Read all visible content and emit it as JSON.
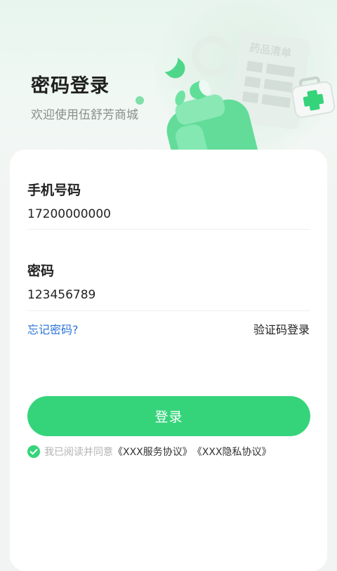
{
  "header": {
    "title": "密码登录",
    "subtitle": "欢迎使用伍舒芳商城",
    "illustration_sign": "药品清单"
  },
  "form": {
    "phone": {
      "label": "手机号码",
      "value": "17200000000"
    },
    "password": {
      "label": "密码",
      "value": "123456789"
    },
    "forgot_label": "忘记密码?",
    "code_login_label": "验证码登录",
    "submit_label": "登录"
  },
  "agreement": {
    "checked": true,
    "prefix": "我已阅读并同意",
    "service_link": "《XXX服务协议》",
    "privacy_link": "《XXX隐私协议》"
  },
  "colors": {
    "accent": "#35d47b",
    "link": "#2b74d8"
  },
  "icons": [
    "medicine-bottle-icon",
    "capsule-icon",
    "first-aid-kit-icon",
    "checkmark-icon"
  ]
}
